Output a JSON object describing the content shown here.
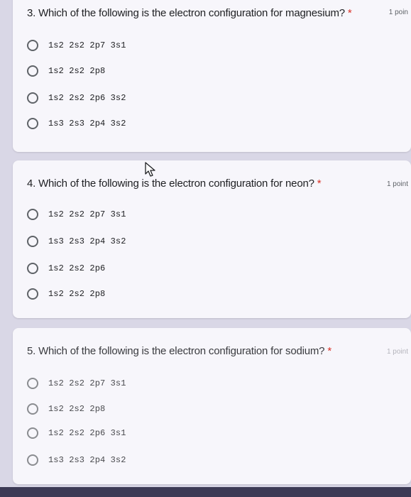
{
  "questions": [
    {
      "title": "3. Which of the following is the electron configuration for magnesium?",
      "required_marker": "*",
      "points": "1 poin",
      "options": [
        "1s2 2s2 2p7 3s1",
        "1s2 2s2 2p8",
        "1s2 2s2 2p6 3s2",
        "1s3 2s3 2p4 3s2"
      ]
    },
    {
      "title": "4. Which of the following is the electron configuration for neon?",
      "required_marker": "*",
      "points": "1 point",
      "options": [
        "1s2 2s2 2p7 3s1",
        "1s3 2s3 2p4 3s2",
        "1s2 2s2 2p6",
        "1s2 2s2 2p8"
      ]
    },
    {
      "title": "5. Which of the following is the electron configuration for sodium?",
      "required_marker": "*",
      "points": "1 point",
      "options": [
        "1s2 2s2 2p7 3s1",
        "1s2 2s2 2p8",
        "1s2 2s2 2p6 3s1",
        "1s3 2s3 2p4 3s2"
      ]
    }
  ],
  "icons": {
    "cursor": "mouse-pointer-icon",
    "radio": "radio-unselected-icon"
  },
  "colors": {
    "background": "#d9d7e6",
    "card": "#f7f6fb",
    "required": "#d93025"
  }
}
